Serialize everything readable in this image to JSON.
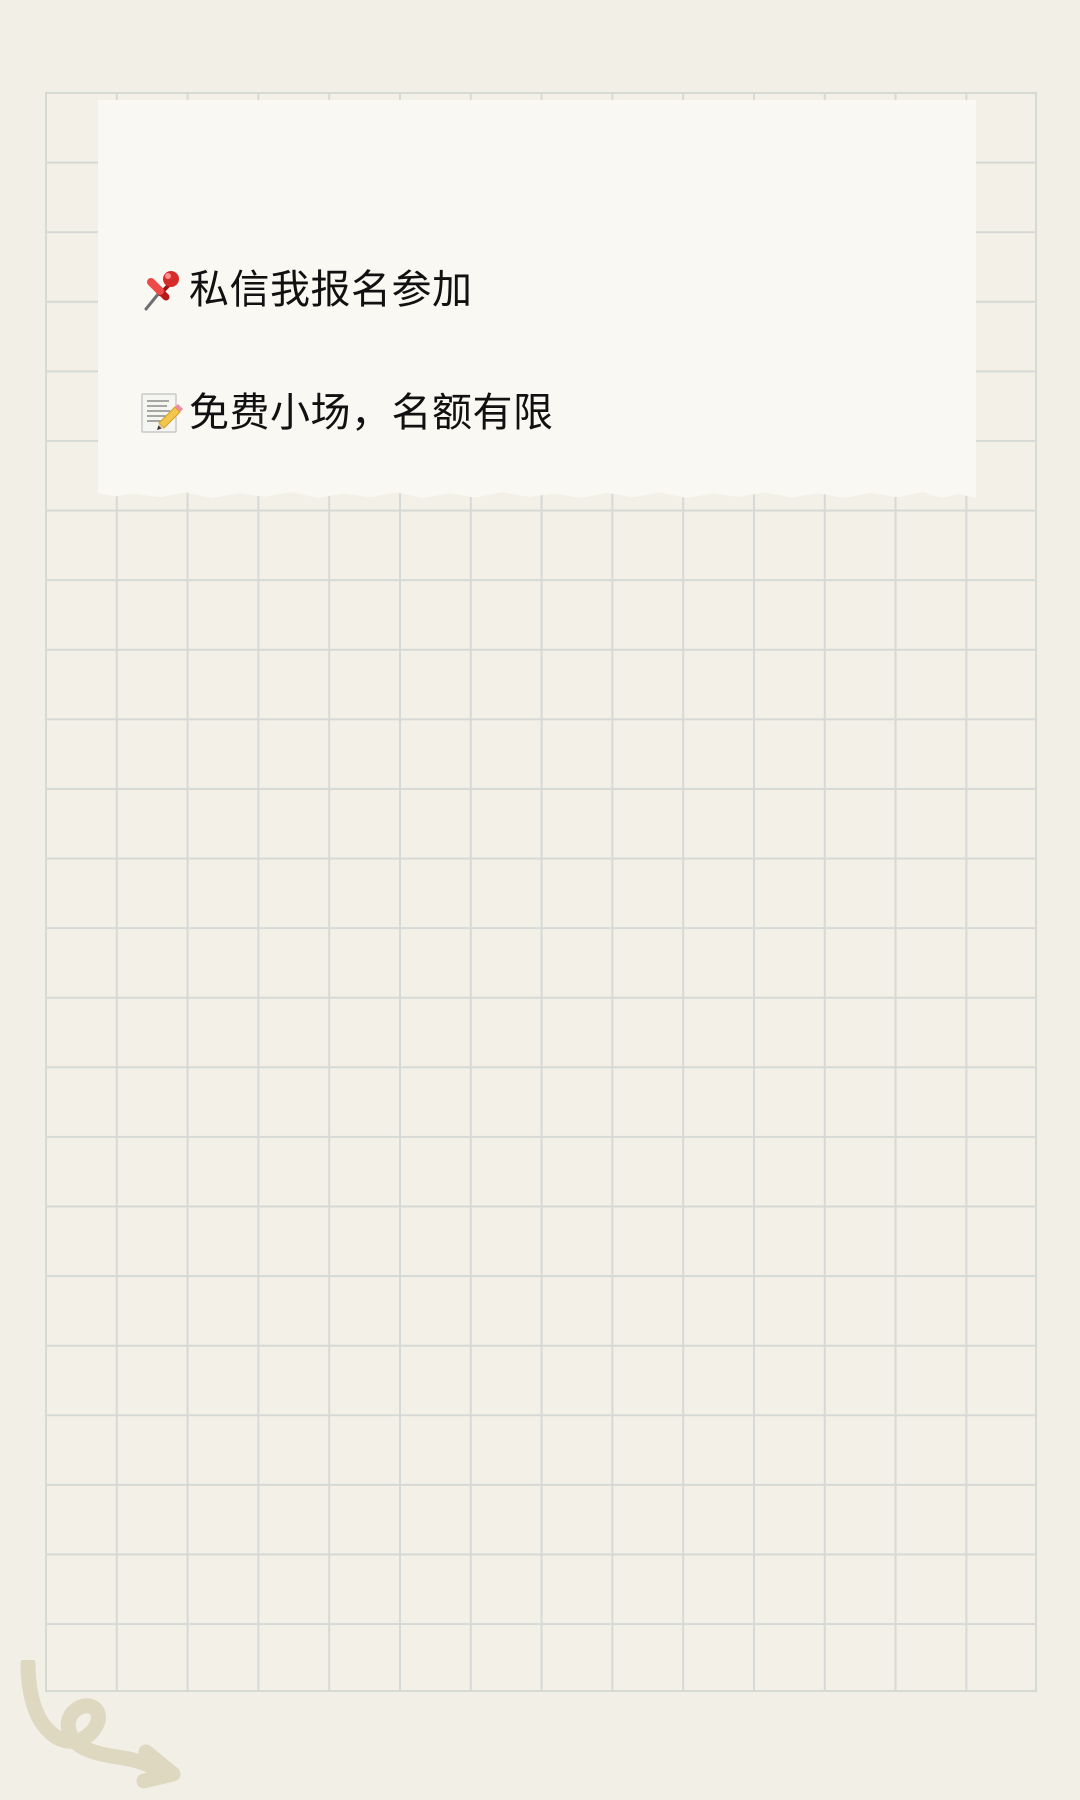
{
  "notes": [
    {
      "icon": "pushpin-icon",
      "text": "私信我报名参加"
    },
    {
      "icon": "memo-icon",
      "text": "免费小场，名额有限"
    }
  ],
  "colors": {
    "background": "#f2efe7",
    "grid": "#d6d9d5",
    "card": "#faf8f3",
    "text": "#111111",
    "doodle": "#ddd7bf"
  }
}
